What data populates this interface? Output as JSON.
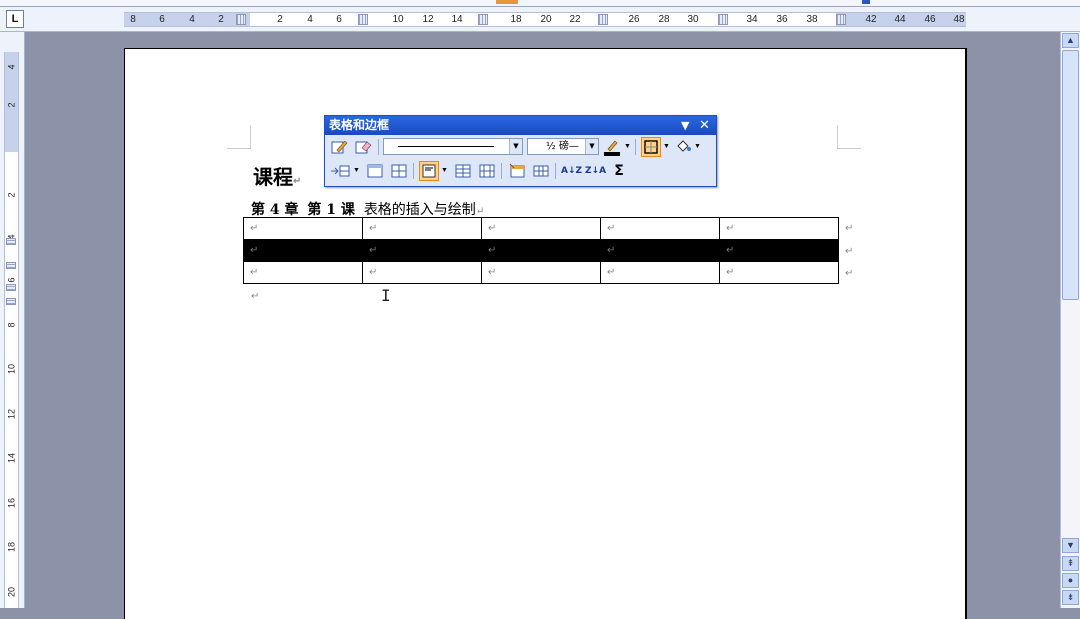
{
  "ruler": {
    "tab_selector": "L",
    "left_ticks": [
      "8",
      "6",
      "4",
      "2"
    ],
    "ticks_a": [
      "2",
      "4",
      "6"
    ],
    "ticks_b": [
      "10",
      "12",
      "14"
    ],
    "ticks_c": [
      "18",
      "20",
      "22"
    ],
    "ticks_d": [
      "26",
      "28",
      "30"
    ],
    "ticks_e": [
      "34",
      "36",
      "38"
    ],
    "ticks_f": [
      "42",
      "44",
      "46",
      "48"
    ],
    "vertical_ticks": [
      "4",
      "2",
      "2",
      "4",
      "6",
      "8",
      "10",
      "12",
      "14",
      "16",
      "18",
      "20"
    ]
  },
  "document": {
    "title": "课程",
    "subtitle_chapter": "第 4 章",
    "subtitle_lesson": "第 1 课",
    "subtitle_text": "表格的插入与绘制",
    "paragraph_mark": "↵",
    "table": {
      "rows": [
        [
          "↵",
          "↵",
          "↵",
          "↵",
          "↵"
        ],
        [
          "↵",
          "↵",
          "↵",
          "↵",
          "↵"
        ],
        [
          "↵",
          "↵",
          "↵",
          "↵",
          "↵"
        ]
      ],
      "selected_row_index": 1
    }
  },
  "toolbar": {
    "title": "表格和边框",
    "line_weight": "½ 磅",
    "line_weight_suffix": "—",
    "sum_label": "Σ",
    "sort_asc_label": "A↓Z",
    "sort_desc_label": "Z↓A"
  },
  "colors": {
    "accent": "#1e4fc7",
    "selection": "#000000",
    "active_button": "#ffd28a"
  }
}
